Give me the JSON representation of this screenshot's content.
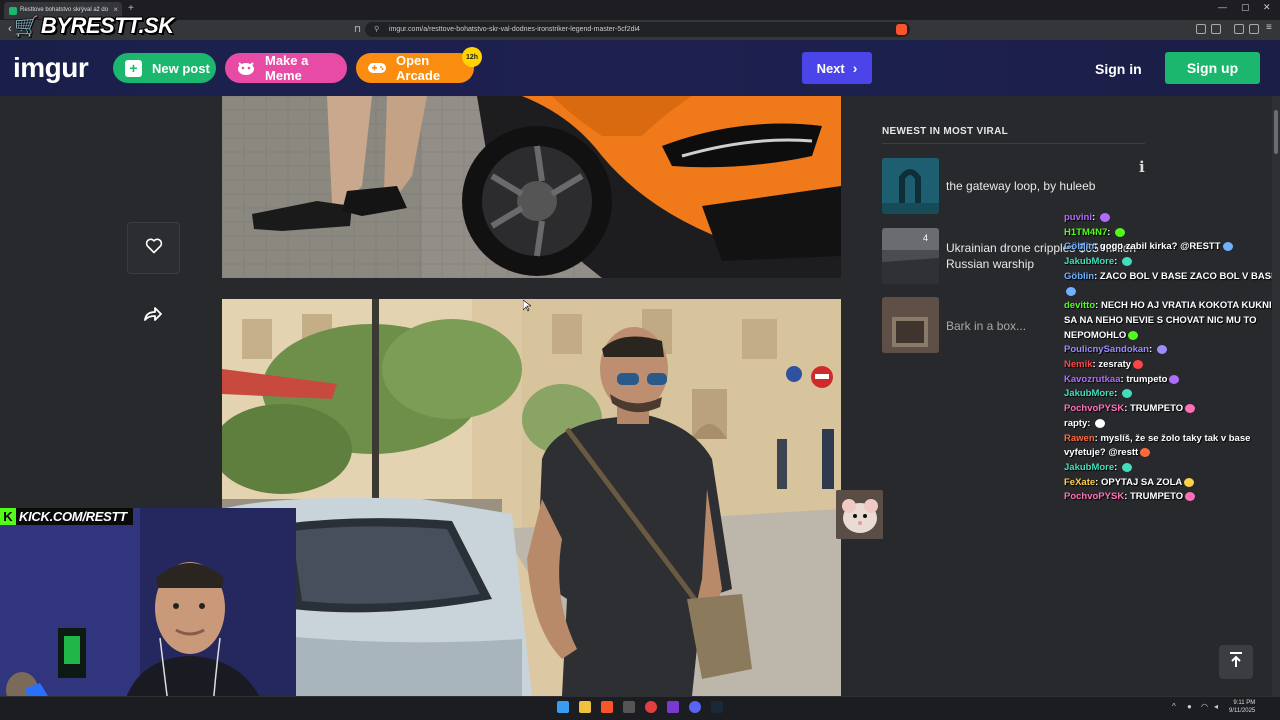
{
  "browser": {
    "tab_title": "Resttove bohatstvo skrýval až do",
    "new_tab": "+",
    "close_tab": "×",
    "url": "imgur.com/a/resttove-bohatstvo-skr-val-dodnes-ironstriker-legend-master-5cf2di4"
  },
  "stream_overlay": {
    "logo_text": "BYRESTT.SK",
    "kick_url": "KICK.COM/RESTT"
  },
  "header": {
    "logo": "imgur",
    "new_post": "New post",
    "make_meme": "Make a Meme",
    "open_arcade": "Open Arcade",
    "arcade_badge": "12h",
    "next": "Next",
    "sign_in": "Sign in",
    "sign_up": "Sign up"
  },
  "sidebar": {
    "title": "NEWEST IN MOST VIRAL",
    "items": [
      {
        "title": "the gateway loop, by huleeb",
        "count": ""
      },
      {
        "title": "Ukrainian drone cripples $65 million Russian warship",
        "count": "4"
      },
      {
        "title": "Bark in a box...",
        "count": ""
      }
    ]
  },
  "chat": [
    {
      "user": "puvini",
      "msg": "",
      "color": "#b06bff"
    },
    {
      "user": "H1TM4N7",
      "msg": "",
      "color": "#53fc18"
    },
    {
      "user": "Göblin",
      "msg": "gogo zabil kirka? @RESTT",
      "color": "#6fb0ff"
    },
    {
      "user": "JakubMore",
      "msg": "",
      "color": "#44ddbb"
    },
    {
      "user": "Göblin",
      "msg": "ZACO BOL V BASE ZACO BOL V BASE",
      "color": "#6fb0ff"
    },
    {
      "user": "devitto",
      "msg": "NECH HO AJ VRATIA KOKOTA KUKNI SA NA NEHO NEVIE S CHOVAT NIC MU TO NEPOMOHLO",
      "color": "#53fc18"
    },
    {
      "user": "PoulicnySandokan",
      "msg": "",
      "color": "#9b8bff"
    },
    {
      "user": "Nemik",
      "msg": "zesraty",
      "color": "#ff4444"
    },
    {
      "user": "Kavozrutkaa",
      "msg": "trumpeto",
      "color": "#b06bff"
    },
    {
      "user": "JakubMore",
      "msg": "",
      "color": "#44ddbb"
    },
    {
      "user": "PochvoPYSK",
      "msg": "TRUMPETO",
      "color": "#ff6fb5"
    },
    {
      "user": "rapty",
      "msg": "",
      "color": "#ffffff"
    },
    {
      "user": "Rawen",
      "msg": "myslíš, že se žolo taky tak v base vyfetuje? @restt",
      "color": "#ff6a3d"
    },
    {
      "user": "JakubMore",
      "msg": "",
      "color": "#44ddbb"
    },
    {
      "user": "FeXate",
      "msg": "OPYTAJ SA ZOLA",
      "color": "#ffd04a"
    },
    {
      "user": "PochvoPYSK",
      "msg": "TRUMPETO",
      "color": "#ff6fb5"
    }
  ],
  "tray": {
    "time": "9:11 PM",
    "date": "9/11/2025"
  }
}
